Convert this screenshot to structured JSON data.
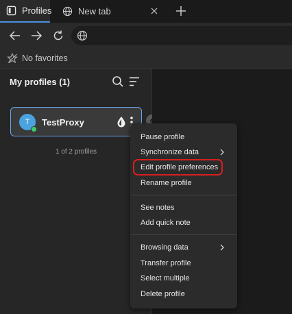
{
  "tabs": [
    {
      "label": "Profiles",
      "icon": "profiles-icon",
      "active": true
    },
    {
      "label": "New tab",
      "icon": "globe-icon",
      "active": false
    }
  ],
  "favorites": {
    "label": "No favorites"
  },
  "sidebar": {
    "title": "My profiles (1)",
    "profile": {
      "name": "TestProxy",
      "initial": "T",
      "status": "online"
    },
    "count": "1 of 2 profiles"
  },
  "menu": {
    "items": [
      {
        "label": "Pause profile",
        "submenu": false
      },
      {
        "label": "Synchronize data",
        "submenu": true
      },
      {
        "label": "Edit profile preferences",
        "submenu": false,
        "highlighted": true
      },
      {
        "label": "Rename profile",
        "submenu": false
      },
      {
        "label": "See notes",
        "submenu": false
      },
      {
        "label": "Add quick note",
        "submenu": false
      },
      {
        "label": "Browsing data",
        "submenu": true
      },
      {
        "label": "Transfer profile",
        "submenu": false
      },
      {
        "label": "Select multiple",
        "submenu": false
      },
      {
        "label": "Delete profile",
        "submenu": false
      }
    ]
  },
  "colors": {
    "accent": "#6aa4ee",
    "highlight": "#d81f1f",
    "online": "#3ccf6e",
    "avatar": "#4aa3df"
  }
}
